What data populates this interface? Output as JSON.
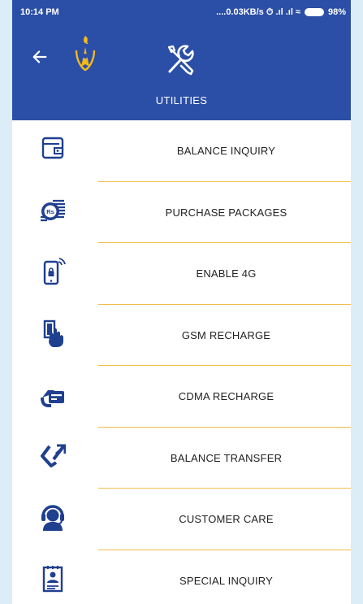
{
  "status_bar": {
    "time": "10:14 PM",
    "network_indicators": "....0.03KB/s ⏱ .ıl .ıl ≈",
    "battery": "98%"
  },
  "header": {
    "title": "UTILITIES",
    "back_icon": "arrow-left-icon",
    "logo_icon": "company-logo",
    "section_icon": "tools-icon"
  },
  "menu": {
    "items": [
      {
        "label": "BALANCE INQUIRY",
        "icon": "wallet-icon"
      },
      {
        "label": "PURCHASE PACKAGES",
        "icon": "rupee-coins-icon"
      },
      {
        "label": "ENABLE 4G",
        "icon": "phone-signal-icon"
      },
      {
        "label": "GSM RECHARGE",
        "icon": "card-insert-icon"
      },
      {
        "label": "CDMA RECHARGE",
        "icon": "card-in-hand-icon"
      },
      {
        "label": "BALANCE TRANSFER",
        "icon": "transfer-icon"
      },
      {
        "label": "CUSTOMER CARE",
        "icon": "headset-icon"
      },
      {
        "label": "SPECIAL INQUIRY",
        "icon": "profile-document-icon"
      }
    ]
  },
  "colors": {
    "primary": "#2b4fa6",
    "divider": "#f0bd4a",
    "icon": "#1f3f8f",
    "frame": "#dcedf7"
  }
}
